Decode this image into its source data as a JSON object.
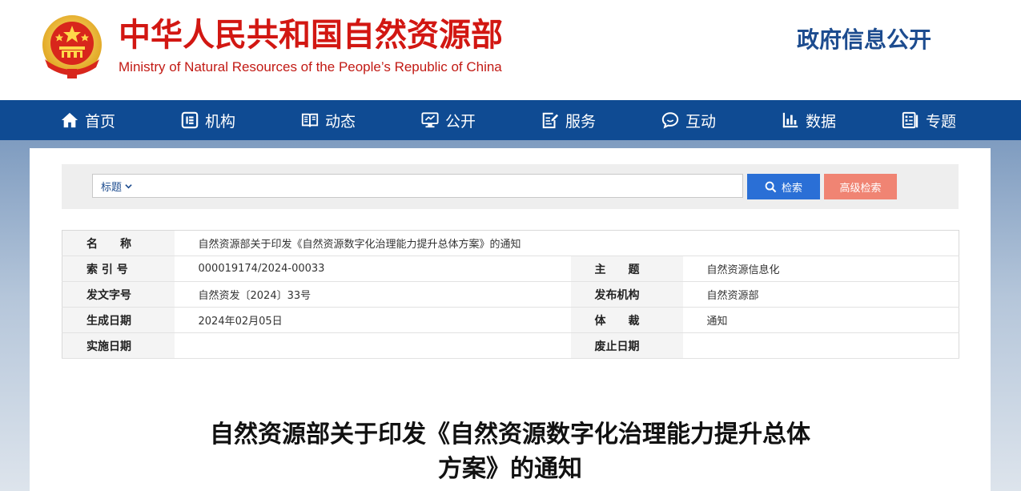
{
  "header": {
    "title_cn": "中华人民共和国自然资源部",
    "title_en": "Ministry of Natural Resources of the People’s Republic of China",
    "right_title": "政府信息公开",
    "colors": {
      "red": "#d21712",
      "blue": "#1d4c8f"
    }
  },
  "nav": {
    "items": [
      {
        "label": "首页",
        "icon": "home-icon"
      },
      {
        "label": "机构",
        "icon": "organization-icon"
      },
      {
        "label": "动态",
        "icon": "book-icon"
      },
      {
        "label": "公开",
        "icon": "monitor-icon"
      },
      {
        "label": "服务",
        "icon": "edit-icon"
      },
      {
        "label": "互动",
        "icon": "chat-icon"
      },
      {
        "label": "数据",
        "icon": "bar-chart-icon"
      },
      {
        "label": "专题",
        "icon": "document-list-icon"
      }
    ],
    "background": "#0f4b93"
  },
  "search": {
    "scope_label": "标题",
    "input_value": "",
    "search_label": "检索",
    "advanced_label": "高级检索",
    "colors": {
      "search": "#2a6fd6",
      "advanced": "#f08473"
    }
  },
  "meta": {
    "name_label": "名　　称",
    "name_value": "自然资源部关于印发《自然资源数字化治理能力提升总体方案》的通知",
    "rows": [
      {
        "k1": "索 引 号",
        "v1": "000019174/2024-00033",
        "k2": "主　　题",
        "v2": "自然资源信息化"
      },
      {
        "k1": "发文字号",
        "v1": "自然资发〔2024〕33号",
        "k2": "发布机构",
        "v2": "自然资源部"
      },
      {
        "k1": "生成日期",
        "v1": "2024年02月05日",
        "k2": "体　　裁",
        "v2": "通知"
      },
      {
        "k1": "实施日期",
        "v1": "",
        "k2": "废止日期",
        "v2": ""
      }
    ]
  },
  "article": {
    "title_line1": "自然资源部关于印发《自然资源数字化治理能力提升总体",
    "title_line2": "方案》的通知"
  }
}
